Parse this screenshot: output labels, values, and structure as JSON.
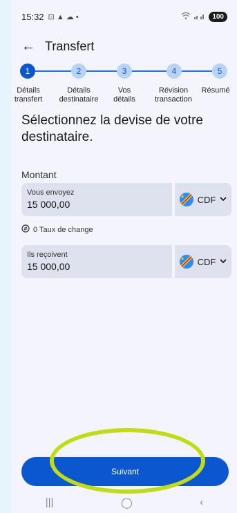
{
  "status": {
    "time": "15:32",
    "icons": "⊡ ▲ ☁ •",
    "battery": "100"
  },
  "appbar": {
    "back": "←",
    "title": "Transfert"
  },
  "stepper": {
    "steps": [
      {
        "num": "1",
        "line1": "Détails",
        "line2": "transfert"
      },
      {
        "num": "2",
        "line1": "Détails",
        "line2": "destinataire"
      },
      {
        "num": "3",
        "line1": "Vos",
        "line2": "détails"
      },
      {
        "num": "4",
        "line1": "Révision",
        "line2": "transaction"
      },
      {
        "num": "5",
        "line1": "Résumé",
        "line2": ""
      }
    ]
  },
  "main": {
    "heading": "Sélectionnez la devise de votre destinataire.",
    "amount_label": "Montant",
    "send": {
      "label": "Vous envoyez",
      "value": "15 000,00",
      "currency": "CDF"
    },
    "rate": "0 Taux de change",
    "receive": {
      "label": "Ils reçoivent",
      "value": "15 000,00",
      "currency": "CDF"
    }
  },
  "footer": {
    "next_label": "Suivant"
  },
  "navbar": {
    "recents": "|||",
    "home": "◯",
    "back": "‹"
  },
  "colors": {
    "accent": "#0b57d0",
    "highlight": "#c2dc14"
  }
}
